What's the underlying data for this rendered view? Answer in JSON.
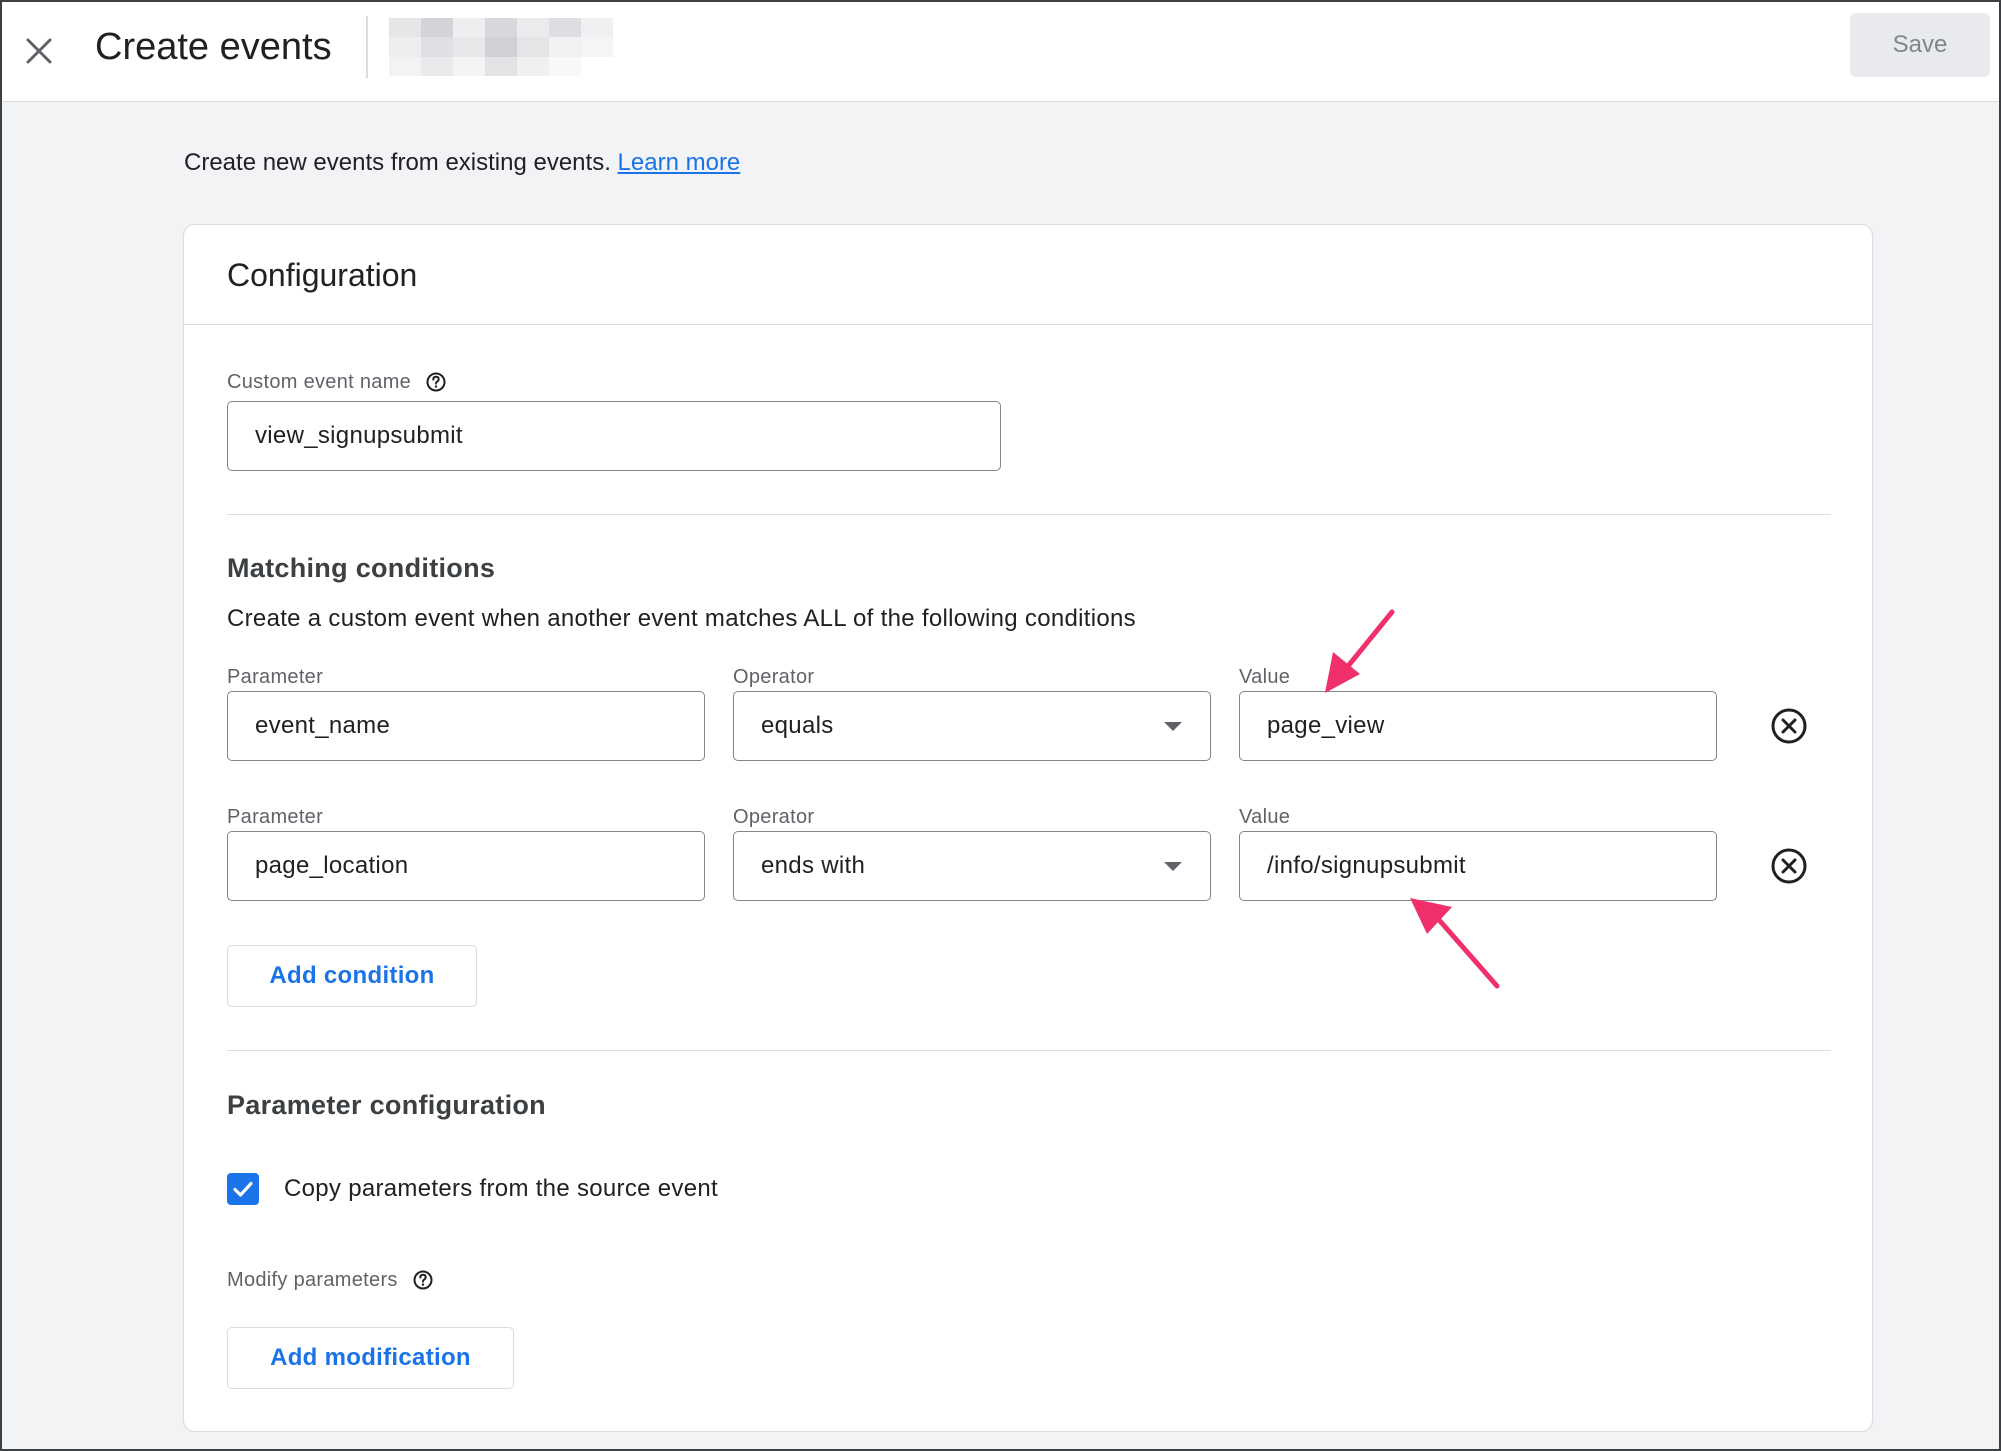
{
  "header": {
    "title": "Create events",
    "save_label": "Save"
  },
  "intro": {
    "text": "Create new events from existing events.",
    "link": "Learn more"
  },
  "card": {
    "title": "Configuration",
    "custom_event": {
      "label": "Custom event name",
      "value": "view_signupsubmit"
    },
    "matching": {
      "title": "Matching conditions",
      "description": "Create a custom event when another event matches ALL of the following conditions",
      "conditions": [
        {
          "parameter_label": "Parameter",
          "parameter": "event_name",
          "operator_label": "Operator",
          "operator": "equals",
          "value_label": "Value",
          "value": "page_view"
        },
        {
          "parameter_label": "Parameter",
          "parameter": "page_location",
          "operator_label": "Operator",
          "operator": "ends with",
          "value_label": "Value",
          "value": "/info/signupsubmit"
        }
      ],
      "add_condition_label": "Add condition"
    },
    "parameter_config": {
      "title": "Parameter configuration",
      "copy_label": "Copy parameters from the source event",
      "copy_checked": true,
      "modify_label": "Modify parameters",
      "add_modification_label": "Add modification"
    }
  },
  "colors": {
    "accent": "#1a73e8",
    "annotation": "#f0306a"
  },
  "icons": {
    "close": "close-icon",
    "help": "help-circle-icon",
    "remove": "remove-circle-icon",
    "dropdown": "caret-down-icon",
    "check": "check-icon"
  }
}
